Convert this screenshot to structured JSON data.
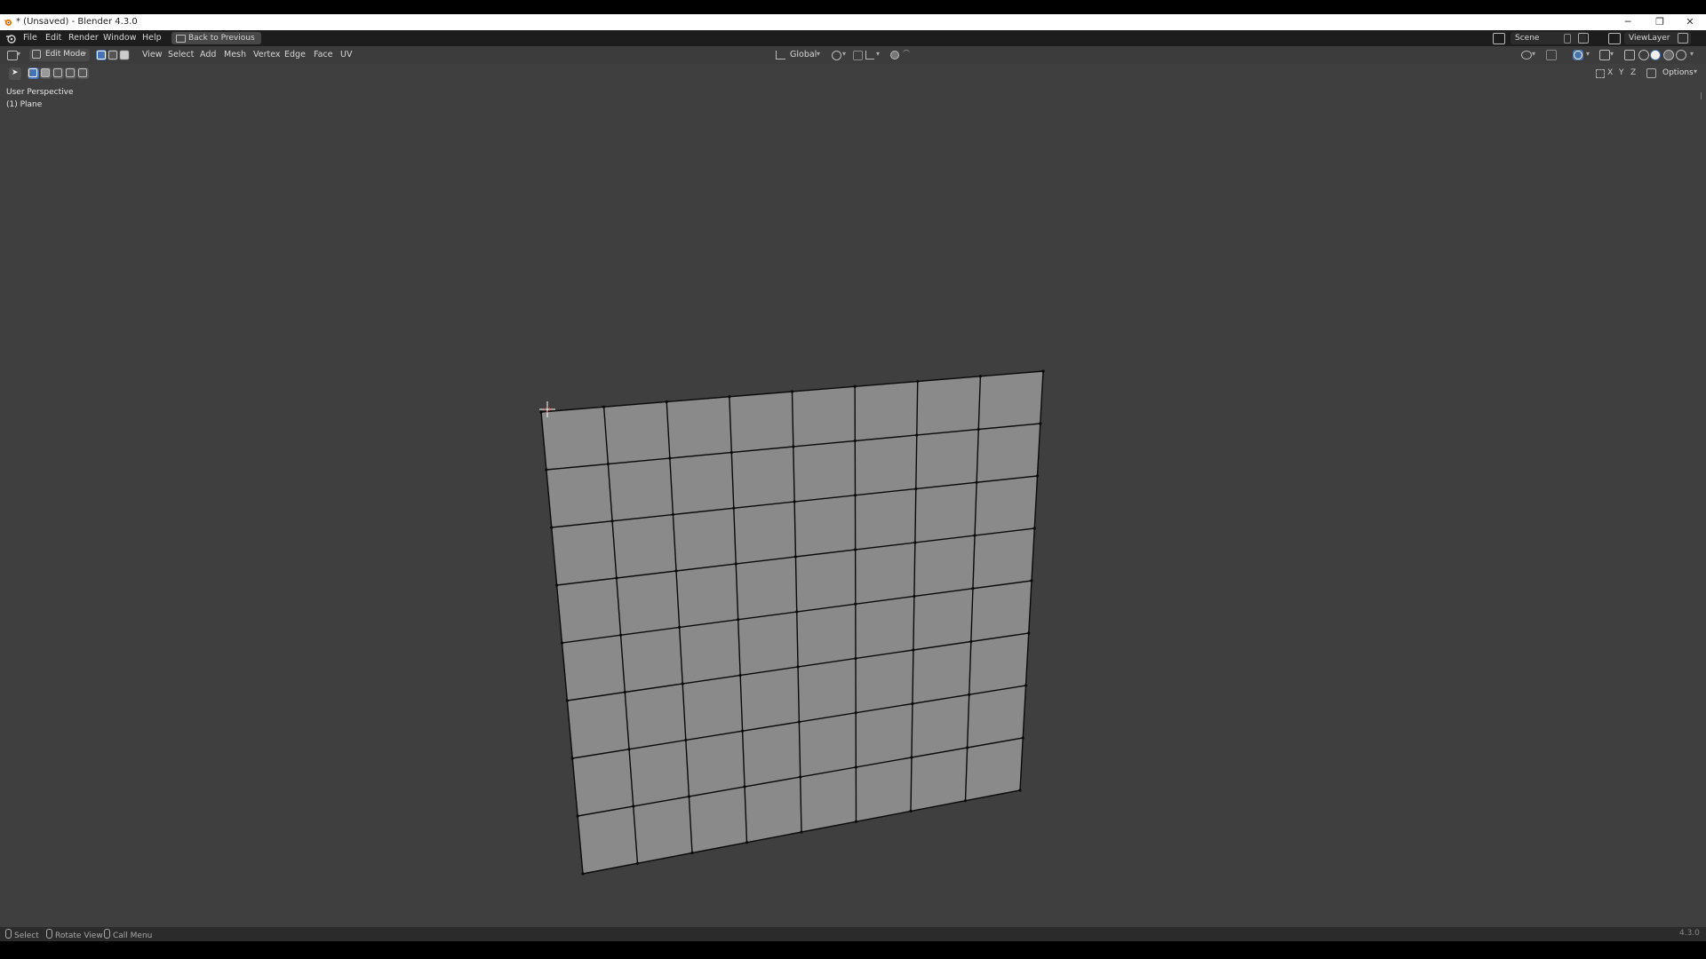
{
  "window": {
    "title": "* (Unsaved) - Blender 4.3.0",
    "controls": [
      "─",
      "❐",
      "✕"
    ]
  },
  "menubar": {
    "items": [
      "File",
      "Edit",
      "Render",
      "Window",
      "Help"
    ],
    "back_button": "Back to Previous",
    "scene_label": "Scene",
    "view_layer_label": "ViewLayer"
  },
  "viewport_header": {
    "mode": "Edit Mode",
    "menus": [
      "View",
      "Select",
      "Add",
      "Mesh",
      "Vertex",
      "Edge",
      "Face",
      "UV"
    ],
    "transform_orientation": "Global",
    "options_label": "Options",
    "axis_labels": [
      "X",
      "Y",
      "Z"
    ]
  },
  "viewport": {
    "view_name": "User Perspective",
    "object_name": "(1) Plane",
    "mesh": {
      "type": "subdivided plane",
      "columns": 8,
      "rows": 8
    }
  },
  "statusbar": {
    "items": [
      "Select",
      "Rotate View",
      "Call Menu"
    ],
    "version": "4.3.0"
  },
  "colors": {
    "viewport_bg": "#3f3f3f",
    "mesh_face": "#8a8a8a",
    "mesh_edge": "#0a0a0a",
    "active_accent": "#4772b3"
  }
}
